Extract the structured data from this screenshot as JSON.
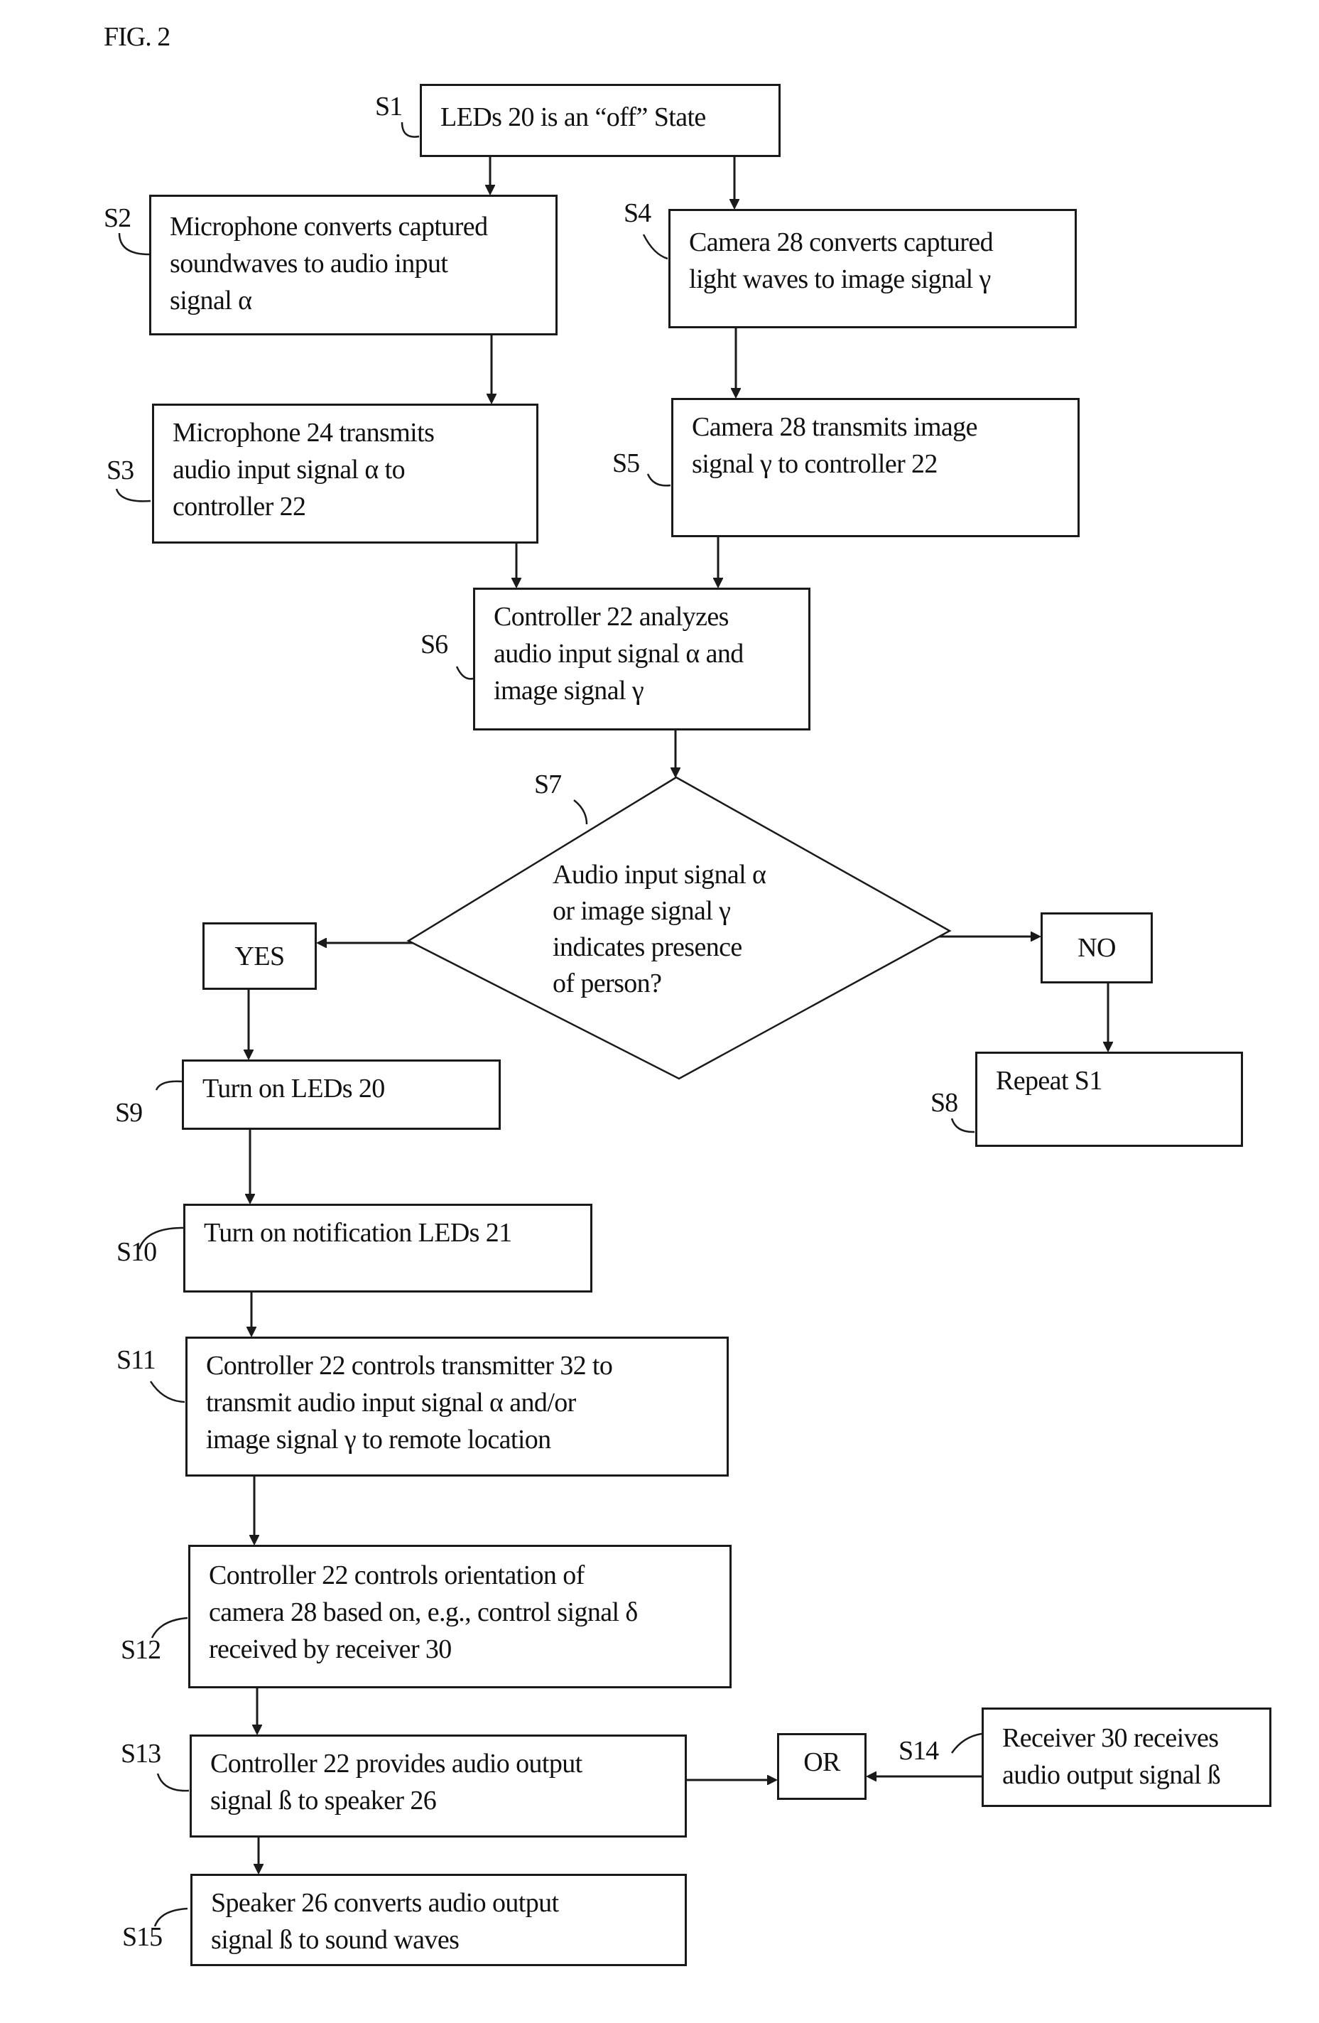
{
  "figure": {
    "title": "FIG. 2"
  },
  "steps": {
    "s1": {
      "label": "S1",
      "text": "LEDs 20 is an “off” State"
    },
    "s2": {
      "label": "S2",
      "text": "Microphone converts captured\nsoundwaves to audio input\nsignal α"
    },
    "s3": {
      "label": "S3",
      "text": "Microphone 24 transmits\naudio input signal α to\ncontroller 22"
    },
    "s4": {
      "label": "S4",
      "text": "Camera 28 converts captured\nlight waves to image signal γ"
    },
    "s5": {
      "label": "S5",
      "text": "Camera 28 transmits image\nsignal γ to controller 22"
    },
    "s6": {
      "label": "S6",
      "text": "Controller 22 analyzes\naudio input signal α and\nimage signal γ"
    },
    "s7": {
      "label": "S7",
      "text": "Audio input signal α\nor image signal γ\nindicates presence\nof person?"
    },
    "s8": {
      "label": "S8",
      "text": "Repeat S1"
    },
    "s9": {
      "label": "S9",
      "text": "Turn on LEDs 20"
    },
    "s10": {
      "label": "S10",
      "text": "Turn on notification LEDs 21"
    },
    "s11": {
      "label": "S11",
      "text": "Controller 22 controls transmitter 32 to\ntransmit audio input signal α and/or\nimage signal γ to remote location"
    },
    "s12": {
      "label": "S12",
      "text": "Controller 22 controls orientation of\ncamera 28 based on, e.g., control signal δ\nreceived by receiver 30"
    },
    "s13": {
      "label": "S13",
      "text": "Controller 22 provides audio output\nsignal ß to speaker 26"
    },
    "s14": {
      "label": "S14",
      "text": "Receiver 30 receives\naudio output signal ß"
    },
    "s15": {
      "label": "S15",
      "text": "Speaker 26 converts audio output\nsignal ß to sound waves"
    }
  },
  "branches": {
    "yes": "YES",
    "no": "NO",
    "or": "OR"
  }
}
